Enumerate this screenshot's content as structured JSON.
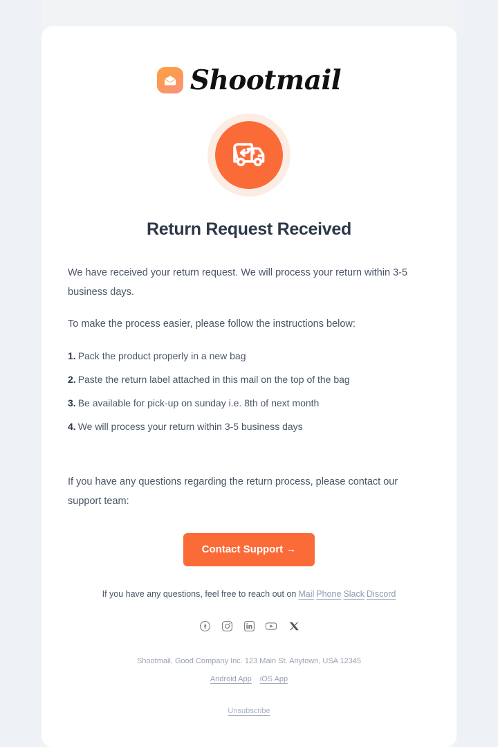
{
  "brand": {
    "logo_icon": "envelope-icon",
    "name": "Shootmail"
  },
  "hero": {
    "icon": "return-truck-icon",
    "disc_color": "#fb6b38",
    "ring_color": "#fdece4"
  },
  "main": {
    "title": "Return Request Received",
    "intro": "We have received your return request. We will process your return within 3-5 business days.",
    "instructions_lead": "To make the process easier, please follow the instructions below:",
    "steps": [
      {
        "num": "1.",
        "text": "Pack the product properly in a new bag"
      },
      {
        "num": "2.",
        "text": "Paste the return label attached in this mail on the top of the bag"
      },
      {
        "num": "3.",
        "text": "Be available for pick-up on sunday i.e. 8th of next month"
      },
      {
        "num": "4.",
        "text": "We will process your return within 3-5 business days"
      }
    ],
    "support_note": "If you have any questions regarding the return process, please contact our support team:",
    "cta_label": "Contact Support →",
    "cta_color": "#fb6b38"
  },
  "footer": {
    "reach_text": "If you have any questions, feel free to reach out on",
    "reach_links": [
      "Mail",
      "Phone",
      "Slack",
      "Discord"
    ],
    "socials": [
      "facebook-icon",
      "instagram-icon",
      "linkedin-icon",
      "youtube-icon",
      "x-icon"
    ],
    "address": "Shootmail, Good Company Inc. 123 Main St. Anytown, USA 12345",
    "app_links": [
      "Android App",
      "iOS App"
    ],
    "unsubscribe": "Unsubscribe"
  }
}
